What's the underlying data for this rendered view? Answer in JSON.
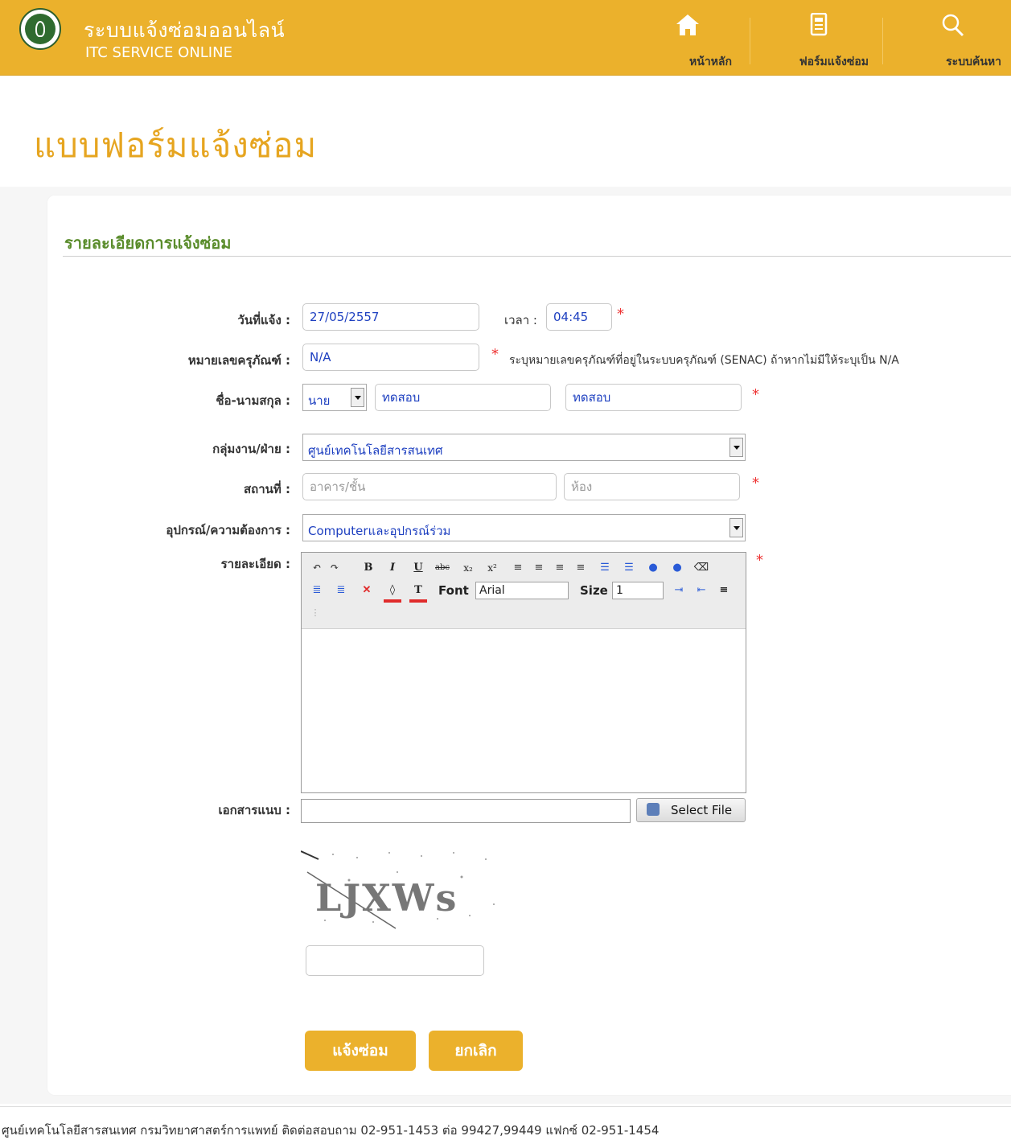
{
  "header": {
    "title_th": "ระบบแจ้งซ่อมออนไลน์",
    "title_en": "ITC SERVICE ONLINE",
    "nav": [
      {
        "label": "หน้าหลัก",
        "icon": "home-icon"
      },
      {
        "label": "ฟอร์มแจ้งซ่อม",
        "icon": "form-icon"
      },
      {
        "label": "ระบบค้นหา",
        "icon": "search-icon"
      }
    ]
  },
  "page": {
    "title": "แบบฟอร์มแจ้งซ่อม",
    "section_title": "รายละเอียดการแจ้งซ่อม"
  },
  "form": {
    "date_label": "วันที่แจ้ง :",
    "date_value": "27/05/2557",
    "time_label": "เวลา :",
    "time_value": "04:45",
    "asset_label": "หมายเลขครุภัณฑ์ :",
    "asset_value": "N/A",
    "asset_hint": "ระบุหมายเลขครุภัณฑ์ที่อยู่ในระบบครุภัณฑ์ (SENAC) ถ้าหากไม่มีให้ระบุเป็น N/A",
    "name_label": "ชื่อ-นามสกุล :",
    "title_value": "นาย",
    "first_name": "ทดสอบ",
    "last_name": "ทดสอบ",
    "dept_label": "กลุ่มงาน/ฝ่าย :",
    "dept_value": "ศูนย์เทคโนโลยีสารสนเทศ",
    "location_label": "สถานที่ :",
    "building_placeholder": "อาคาร/ชั้น",
    "room_placeholder": "ห้อง",
    "equipment_label": "อุปกรณ์/ความต้องการ :",
    "equipment_value": "Computerและอุปกรณ์ร่วม",
    "detail_label": "รายละเอียด :",
    "attach_label": "เอกสารแนบ :",
    "select_file": "Select File",
    "captcha_text": "LJXWs",
    "required_mark": "*"
  },
  "editor": {
    "font_label": "Font",
    "font_value": "Arial",
    "size_label": "Size",
    "size_value": "1",
    "bold": "B",
    "italic": "I",
    "underline": "U",
    "strike": "abc",
    "sub": "x₂",
    "sup": "x²",
    "font_color": "T"
  },
  "buttons": {
    "submit": "แจ้งซ่อม",
    "cancel": "ยกเลิก"
  },
  "footer": {
    "text": "ศูนย์เทคโนโลยีสารสนเทศ กรมวิทยาศาสตร์การแพทย์ ติดต่อสอบถาม 02-951-1453 ต่อ 99427,99449 แฟกซ์ 02-951-1454"
  },
  "colors": {
    "brand": "#ebb12c",
    "section": "#5a8c2b",
    "required": "#e33333"
  }
}
